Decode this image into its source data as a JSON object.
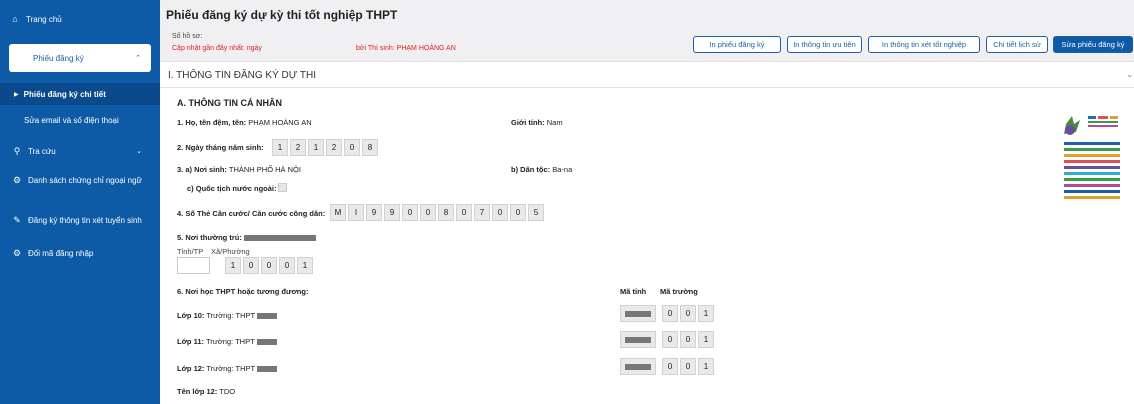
{
  "sidebar": {
    "home": "Trang chủ",
    "reg": "Phiếu đăng ký",
    "reg_detail": "Phiếu đăng ký chi tiết",
    "edit_email": "Sửa email và số điện thoại",
    "lookup": "Tra cứu",
    "cert_list": "Danh sách chứng chỉ ngoại ngữ",
    "admission": "Đăng ký thông tin xét tuyển sinh",
    "change_code": "Đổi mã đăng nhập"
  },
  "header": {
    "title": "Phiếu đăng ký dự kỳ thi tốt nghiệp THPT",
    "file_no_label": "Số hồ sơ:",
    "update_prefix": "Cập nhật gần đây nhất: ngày",
    "update_suffix": "bởi Thí sinh: PHẠM HOÀNG AN",
    "buttons": [
      "In phiếu đăng ký",
      "In thông tin ưu tiên",
      "In thông tin xét tốt nghiệp",
      "Chi tiết lịch sử",
      "Sửa phiếu đăng ký"
    ]
  },
  "section": {
    "title": "I. THÔNG TIN ĐĂNG KÝ DỰ THI",
    "sub": "A. THÔNG TIN CÁ NHÂN"
  },
  "form": {
    "name_label": "1. Họ, tên đệm, tên:",
    "name_value": "PHẠM HOÀNG AN",
    "gender_label": "Giới tính:",
    "gender_value": "Nam",
    "dob_label": "2. Ngày tháng năm sinh:",
    "dob_digits": [
      "1",
      "2",
      "1",
      "2",
      "0",
      "8"
    ],
    "birthplace_label": "3. a) Nơi sinh:",
    "birthplace_value": "THÀNH PHỐ HÀ NỘI",
    "ethnic_label": "b) Dân tộc:",
    "ethnic_value": "Ba-na",
    "foreign_label": "c) Quốc tịch nước ngoài:",
    "id_label": "4. Số Thẻ Căn cước/ Căn cước công dân:",
    "id_digits": [
      "M",
      "I",
      "9",
      "9",
      "0",
      "0",
      "8",
      "0",
      "7",
      "0",
      "0",
      "5"
    ],
    "residence_label": "5. Nơi thường trú:",
    "province_label": "Tỉnh/TP",
    "ward_label": "Xã/Phường",
    "ward_digits": [
      "1",
      "0",
      "0",
      "0",
      "1"
    ],
    "school_label": "6. Nơi học THPT hoặc tương đương:",
    "col_province": "Mã tỉnh",
    "col_school": "Mã trường",
    "grades": [
      {
        "label": "Lớp 10:",
        "school": "Trường: THPT",
        "code": [
          "0",
          "0",
          "1"
        ]
      },
      {
        "label": "Lớp 11:",
        "school": "Trường: THPT",
        "code": [
          "0",
          "0",
          "1"
        ]
      },
      {
        "label": "Lớp 12:",
        "school": "Trường: THPT",
        "code": [
          "0",
          "0",
          "1"
        ]
      }
    ],
    "class_label": "Tên lớp 12:",
    "class_value": "TDO"
  }
}
